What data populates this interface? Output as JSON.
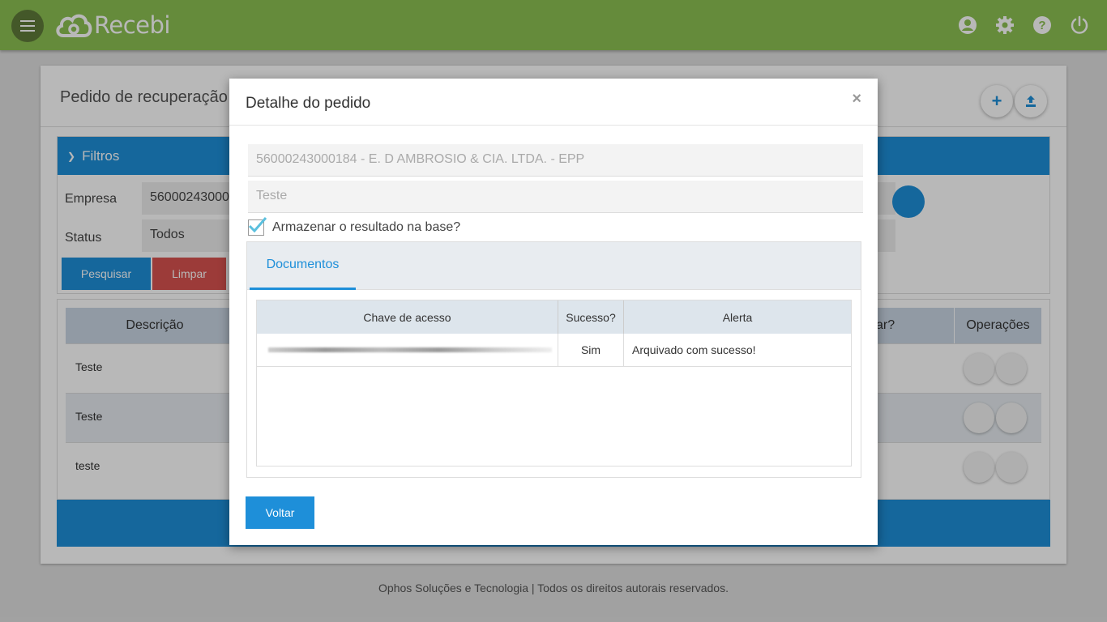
{
  "app": {
    "name": "Recebi"
  },
  "header": {
    "icons": [
      "user-icon",
      "gear-icon",
      "help-icon",
      "power-icon"
    ]
  },
  "page": {
    "title": "Pedido de recuperação d",
    "filters": {
      "title": "Filtros",
      "empresa_label": "Empresa",
      "empresa_value": "56000243000",
      "status_label": "Status",
      "status_value": "Todos",
      "search_button": "Pesquisar",
      "clear_button": "Limpar"
    },
    "table": {
      "columns": {
        "descricao": "Descrição",
        "armazenar": "ar?",
        "operacoes": "Operações"
      },
      "rows": [
        {
          "descricao": "Teste"
        },
        {
          "descricao": "Teste"
        },
        {
          "descricao": "teste"
        }
      ]
    }
  },
  "footer": {
    "text": "Ophos Soluções e Tecnologia | Todos os direitos autorais reservados."
  },
  "modal": {
    "title": "Detalhe do pedido",
    "close": "×",
    "empresa": "56000243000184 - E. D AMBROSIO & CIA. LTDA. - EPP",
    "descricao": "Teste",
    "checkbox_label": "Armazenar o resultado na base?",
    "checkbox_checked": true,
    "tab": "Documentos",
    "doc_table": {
      "columns": [
        "Chave de acesso",
        "Sucesso?",
        "Alerta"
      ],
      "rows": [
        {
          "chave": "",
          "sucesso": "Sim",
          "alerta": "Arquivado com sucesso!"
        }
      ]
    },
    "back_button": "Voltar"
  },
  "colors": {
    "topbar": "#8cc152",
    "primary": "#1e8fd9",
    "danger": "#d9534f"
  }
}
